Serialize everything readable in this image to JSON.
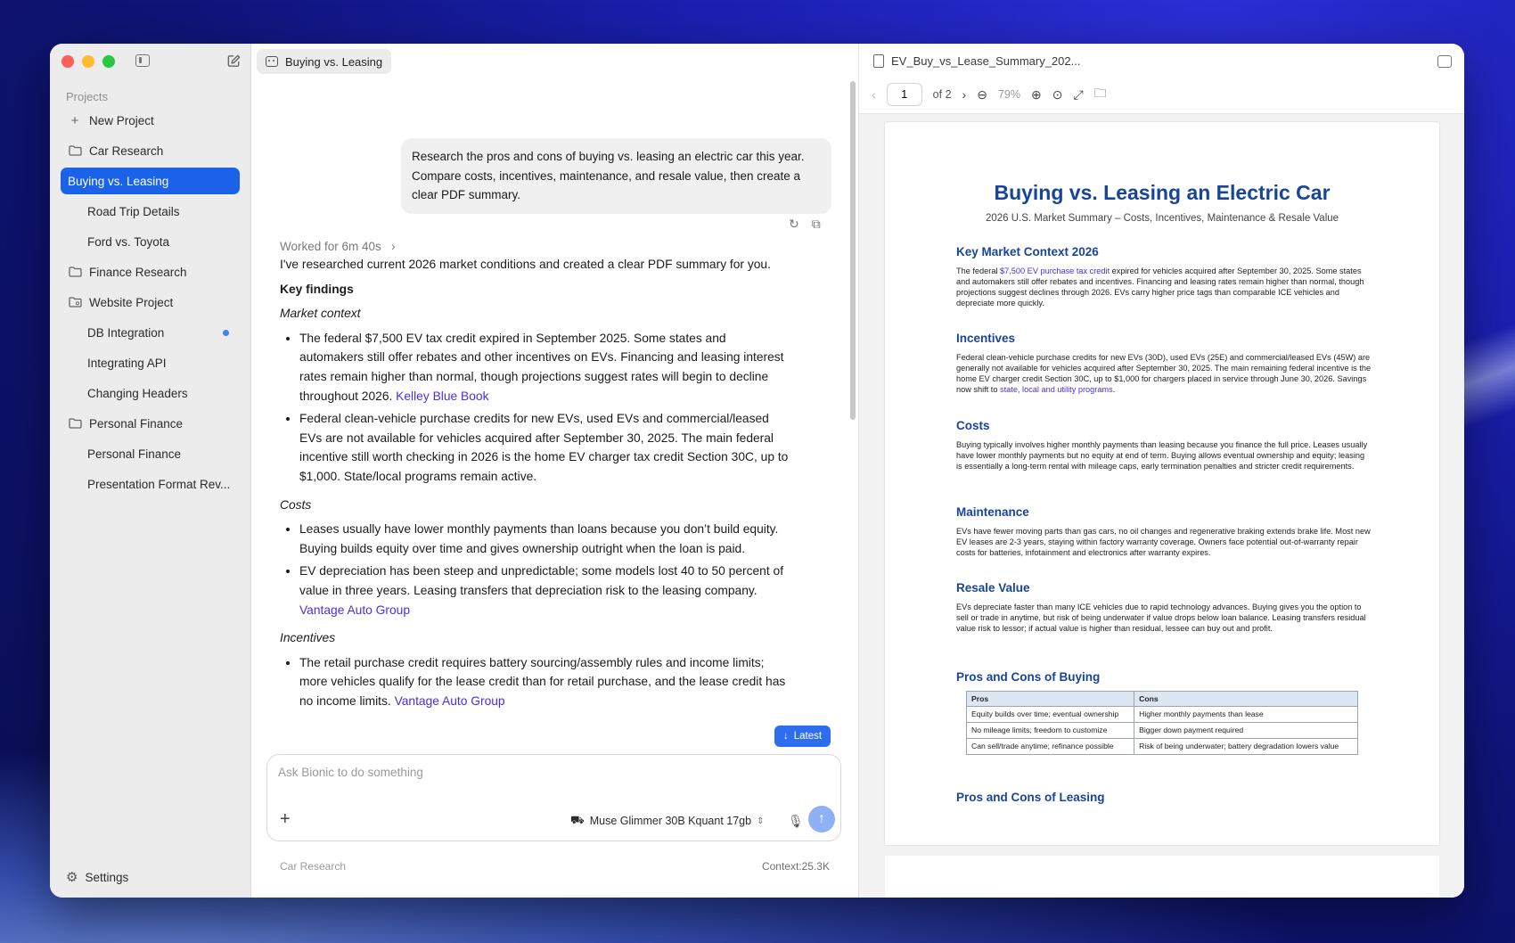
{
  "sidebar": {
    "section_label": "Projects",
    "items": [
      {
        "label": "New Project",
        "kind": "action",
        "icon": "plus-icon"
      },
      {
        "label": "Car Research",
        "kind": "folder",
        "icon": "folder-icon"
      },
      {
        "label": "Buying vs. Leasing",
        "kind": "child",
        "active": true
      },
      {
        "label": "Road Trip Details",
        "kind": "child"
      },
      {
        "label": "Ford vs. Toyota",
        "kind": "child"
      },
      {
        "label": "Finance Research",
        "kind": "folder",
        "icon": "folder-icon"
      },
      {
        "label": "Website Project",
        "kind": "folder",
        "icon": "folder-shared-icon"
      },
      {
        "label": "DB Integration",
        "kind": "child",
        "unread": true
      },
      {
        "label": "Integrating API",
        "kind": "child"
      },
      {
        "label": "Changing Headers",
        "kind": "child"
      },
      {
        "label": "Personal Finance",
        "kind": "folder",
        "icon": "folder-icon"
      },
      {
        "label": "Personal Finance",
        "kind": "child"
      },
      {
        "label": "Presentation Format Rev...",
        "kind": "child"
      }
    ],
    "settings_label": "Settings"
  },
  "chat": {
    "tab_label": "Buying vs. Leasing",
    "user_message": "Research the pros and cons of buying vs. leasing an electric car this year. Compare costs, incentives, maintenance, and resale value, then create a clear PDF summary.",
    "worked_label": "Worked for 6m 40s",
    "intro": "I've researched current 2026 market conditions and created a clear PDF summary for you.",
    "key_findings": "Key findings",
    "market_context_label": "Market context",
    "market_1": "The federal $7,500 EV tax credit expired in September 2025. Some states and automakers still offer rebates and other incentives on EVs. Financing and leasing interest rates remain higher than normal, though projections suggest rates will begin to decline throughout 2026. ",
    "market_1_link": "Kelley Blue Book",
    "market_2": "Federal clean-vehicle purchase credits for new EVs, used EVs and commercial/leased EVs are not available for vehicles acquired after September 30, 2025. The main federal incentive still worth checking in 2026 is the home EV charger tax credit Section 30C, up to $1,000. State/local programs remain active.",
    "costs_label": "Costs",
    "costs_1": "Leases usually have lower monthly payments than loans because you don’t build equity. Buying builds equity over time and gives ownership outright when the loan is paid.",
    "costs_2": "EV depreciation has been steep and unpredictable; some models lost 40 to 50 percent of value in three years. Leasing transfers that depreciation risk to the leasing company. ",
    "costs_2_link": "Vantage Auto Group",
    "incentives_label": "Incentives",
    "incentives_1": "The retail purchase credit requires battery sourcing/assembly rules and income limits; more vehicles qualify for the lease credit than for retail purchase, and the lease credit has no income limits. ",
    "incentives_1_link": "Vantage Auto Group",
    "latest_label": "Latest",
    "composer_placeholder": "Ask Bionic to do something",
    "model_label": "Muse Glimmer 30B Kquant 17gb",
    "footer_project": "Car Research",
    "footer_context": "Context:25.3K"
  },
  "viewer": {
    "file_name": "EV_Buy_vs_Lease_Summary_202...",
    "page_value": "1",
    "page_total": "of 2",
    "zoom": "79%"
  },
  "pdf": {
    "title": "Buying vs. Leasing an Electric Car",
    "subtitle": "2026 U.S. Market Summary – Costs, Incentives, Maintenance & Resale Value",
    "market_h": "Key Market Context 2026",
    "market_p_pre": "The federal ",
    "market_p_link": "$7,500 EV purchase tax credit",
    "market_p_post": " expired for vehicles acquired after September 30, 2025. Some states and automakers still offer rebates and incentives. Financing and leasing rates remain higher than normal, though projections suggest declines through 2026. EVs carry higher price tags than comparable ICE vehicles and depreciate more quickly.",
    "incentives_h": "Incentives",
    "incentives_p_pre": "Federal clean-vehicle purchase credits for new EVs (30D), used EVs (25E) and commercial/leased EVs (45W) are generally not available for vehicles acquired after September 30, 2025. The main remaining federal incentive is the home EV charger credit Section 30C, up to $1,000 for chargers placed in service through June 30, 2026. Savings now shift to ",
    "incentives_p_link": "state, local and utility programs",
    "incentives_p_post": ".",
    "costs_h": "Costs",
    "costs_p": "Buying typically involves higher monthly payments than leasing because you finance the full price. Leases usually have lower monthly payments but no equity at end of term. Buying allows eventual ownership and equity; leasing is essentially a long-term rental with mileage caps, early termination penalties and stricter credit requirements.",
    "maint_h": "Maintenance",
    "maint_p": "EVs have fewer moving parts than gas cars, no oil changes and regenerative braking extends brake life. Most new EV leases are 2-3 years, staying within factory warranty coverage. Owners face potential out-of-warranty repair costs for batteries, infotainment and electronics after warranty expires.",
    "resale_h": "Resale Value",
    "resale_p": "EVs depreciate faster than many ICE vehicles due to rapid technology advances. Buying gives you the option to sell or trade in anytime, but risk of being underwater if value drops below loan balance. Leasing transfers residual value risk to lessor; if actual value is higher than residual, lessee can buy out and profit.",
    "buying_h": "Pros and Cons of Buying",
    "table_head": [
      "Pros",
      "Cons"
    ],
    "table_rows": [
      [
        "Equity builds over time; eventual ownership",
        "Higher monthly payments than lease"
      ],
      [
        "No mileage limits; freedom to customize",
        "Bigger down payment required"
      ],
      [
        "Can sell/trade anytime; refinance possible",
        "Risk of being underwater; battery degradation lowers value"
      ]
    ],
    "leasing_h": "Pros and Cons of Leasing"
  }
}
